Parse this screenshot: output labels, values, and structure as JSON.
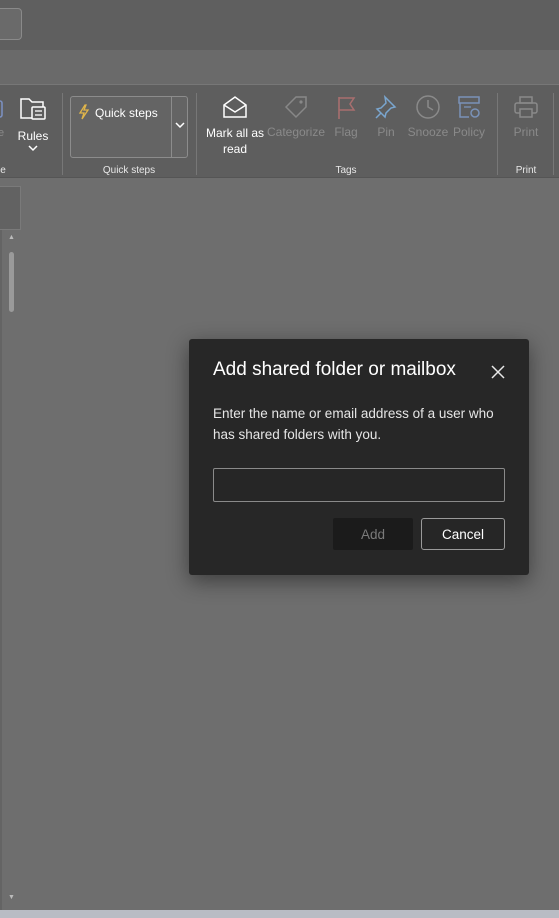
{
  "ribbon": {
    "partial_group_label": "e",
    "partial_button_label": "e",
    "rules_label": "Rules",
    "quick_steps_button": "Quick steps",
    "quick_steps_group": "Quick steps",
    "mark_all_read": "Mark all as read",
    "categorize": "Categorize",
    "flag": "Flag",
    "pin": "Pin",
    "snooze": "Snooze",
    "policy": "Policy",
    "tags_group": "Tags",
    "print_button": "Print",
    "print_group": "Print"
  },
  "dialog": {
    "title": "Add shared folder or mailbox",
    "description": "Enter the name or email address of a user who has shared folders with you.",
    "input_value": "",
    "input_placeholder": "",
    "add_label": "Add",
    "cancel_label": "Cancel"
  },
  "colors": {
    "overlay": "#6e6e6e",
    "dialog_bg": "#272727",
    "flag_disabled": "#a86f6f",
    "pin_accent": "#7aa6cf",
    "quick_steps_bolt": "#e0b54a"
  }
}
